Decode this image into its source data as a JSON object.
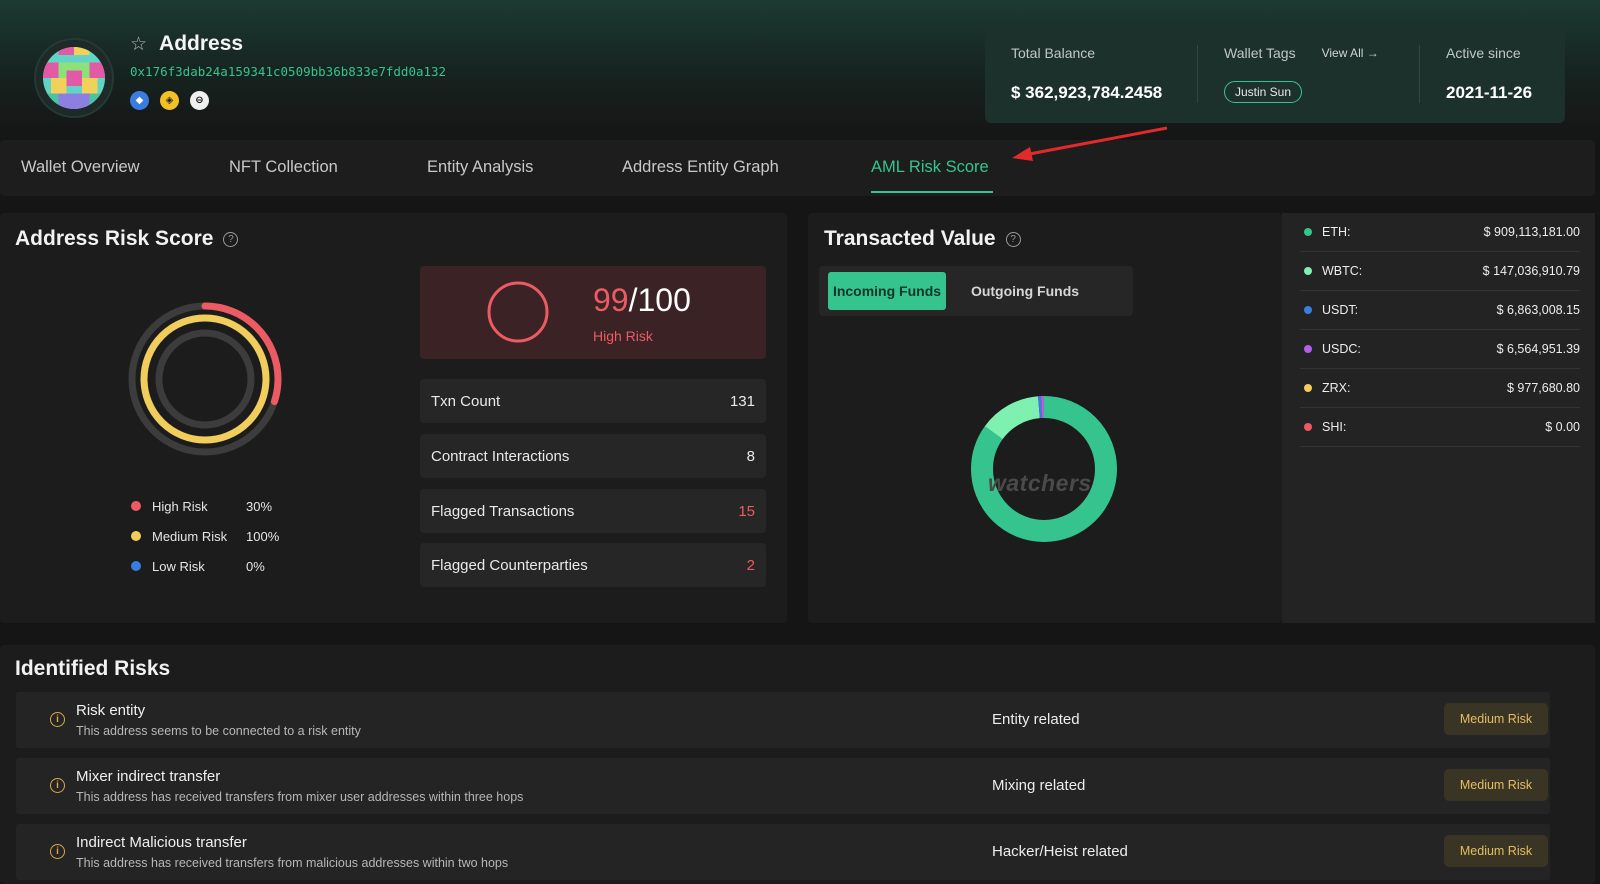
{
  "header": {
    "title": "Address",
    "address_hash": "0x176f3dab24a159341c0509bb36b833e7fdd0a132",
    "chain_icons": [
      "ethereum-icon",
      "binance-icon",
      "coin-icon"
    ],
    "total_balance_label": "Total Balance",
    "total_balance_value": "$ 362,923,784.2458",
    "wallet_tags_label": "Wallet Tags",
    "view_all_label": "View All →",
    "wallet_tag": "Justin Sun",
    "active_since_label": "Active since",
    "active_since_value": "2021-11-26"
  },
  "tabs": [
    {
      "label": "Wallet Overview"
    },
    {
      "label": "NFT Collection"
    },
    {
      "label": "Entity Analysis"
    },
    {
      "label": "Address Entity Graph"
    },
    {
      "label": "AML Risk Score",
      "active": true
    }
  ],
  "risk_score": {
    "title": "Address Risk Score",
    "legend": [
      {
        "label": "High Risk",
        "value": "30%",
        "percent": 30,
        "color": "#ec5b63"
      },
      {
        "label": "Medium Risk",
        "value": "100%",
        "percent": 100,
        "color": "#f1cd5b"
      },
      {
        "label": "Low Risk",
        "value": "0%",
        "percent": 0,
        "color": "#3a7de0"
      }
    ],
    "score": "99",
    "max": "/100",
    "level": "High Risk",
    "stats": [
      {
        "label": "Txn Count",
        "value": "131",
        "highlight": false
      },
      {
        "label": "Contract Interactions",
        "value": "8",
        "highlight": false
      },
      {
        "label": "Flagged Transactions",
        "value": "15",
        "highlight": true
      },
      {
        "label": "Flagged Counterparties",
        "value": "2",
        "highlight": true
      }
    ]
  },
  "transacted": {
    "title": "Transacted Value",
    "incoming_label": "Incoming Funds",
    "outgoing_label": "Outgoing Funds",
    "watermark": "watchers",
    "assets": [
      {
        "name": "ETH:",
        "value": "$ 909,113,181.00",
        "color": "#35c48e"
      },
      {
        "name": "WBTC:",
        "value": "$ 147,036,910.79",
        "color": "#7ef0b0"
      },
      {
        "name": "USDT:",
        "value": "$ 6,863,008.15",
        "color": "#3a7de0"
      },
      {
        "name": "USDC:",
        "value": "$ 6,564,951.39",
        "color": "#b65ee6"
      },
      {
        "name": "ZRX:",
        "value": "$ 977,680.80",
        "color": "#f1cd5b"
      },
      {
        "name": "SHI:",
        "value": "$ 0.00",
        "color": "#ec5b63"
      }
    ]
  },
  "chart_data": {
    "type": "pie",
    "categories": [
      "ETH",
      "WBTC",
      "USDT",
      "USDC",
      "ZRX",
      "SHI"
    ],
    "values": [
      909113181.0,
      147036910.79,
      6863008.15,
      6564951.39,
      977680.8,
      0.0
    ],
    "colors": [
      "#35c48e",
      "#7ef0b0",
      "#3a7de0",
      "#b65ee6",
      "#f1cd5b",
      "#ec5b63"
    ],
    "title": "",
    "legend_position": "right"
  },
  "identified": {
    "title": "Identified Risks",
    "items": [
      {
        "title": "Risk entity",
        "desc": "This address seems to be connected to a risk entity",
        "category": "Entity related",
        "badge": "Medium Risk"
      },
      {
        "title": "Mixer indirect transfer",
        "desc": "This address has received transfers from mixer user addresses within three hops",
        "category": "Mixing related",
        "badge": "Medium Risk"
      },
      {
        "title": "Indirect Malicious transfer",
        "desc": "This address has received transfers from malicious addresses within two hops",
        "category": "Hacker/Heist related",
        "badge": "Medium Risk"
      }
    ]
  }
}
